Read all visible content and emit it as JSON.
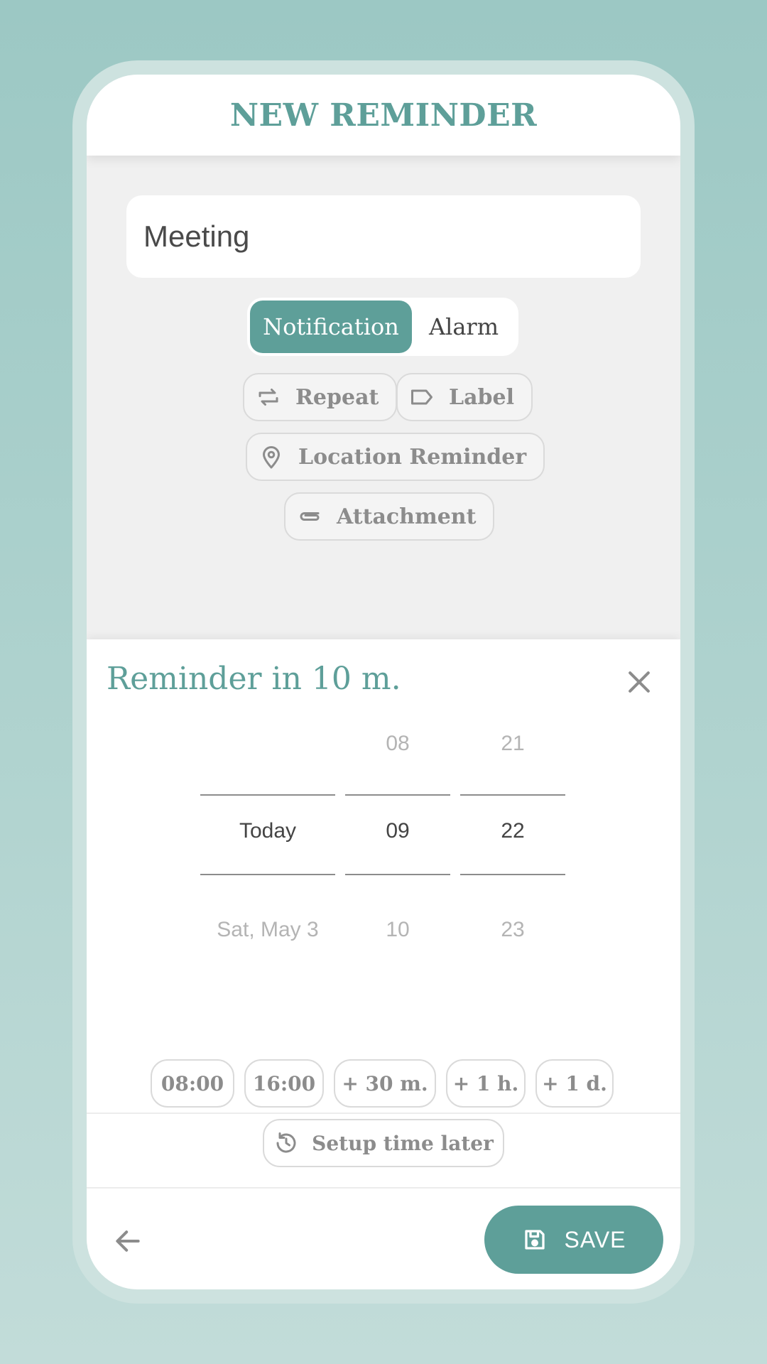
{
  "header": {
    "title": "NEW REMINDER"
  },
  "reminder": {
    "title_value": "Meeting"
  },
  "type_toggle": {
    "notification_label": "Notification",
    "alarm_label": "Alarm",
    "selected": "Notification"
  },
  "options": {
    "repeat_label": "Repeat",
    "label_label": "Label",
    "location_label": "Location Reminder",
    "attachment_label": "Attachment"
  },
  "time_panel": {
    "title": "Reminder in 10 m.",
    "day_column": {
      "prev": "",
      "selected": "Today",
      "next": "Sat, May 3"
    },
    "hour_column": {
      "prev": "08",
      "selected": "09",
      "next": "10"
    },
    "minute_column": {
      "prev": "21",
      "selected": "22",
      "next": "23"
    }
  },
  "quick_times": [
    "08:00",
    "16:00",
    "+ 30 m.",
    "+ 1 h.",
    "+ 1 d."
  ],
  "setup_later_label": "Setup time later",
  "footer": {
    "save_label": "SAVE"
  },
  "icons": {
    "repeat": "repeat-icon",
    "label": "label-tag-icon",
    "location": "location-pin-icon",
    "attachment": "paperclip-icon",
    "close": "close-icon",
    "setup_later": "history-icon",
    "back": "arrow-left-icon",
    "save": "floppy-disk-icon"
  },
  "colors": {
    "accent": "#5e9f99",
    "background": "#9cc8c4",
    "chip_border": "#dadada"
  }
}
